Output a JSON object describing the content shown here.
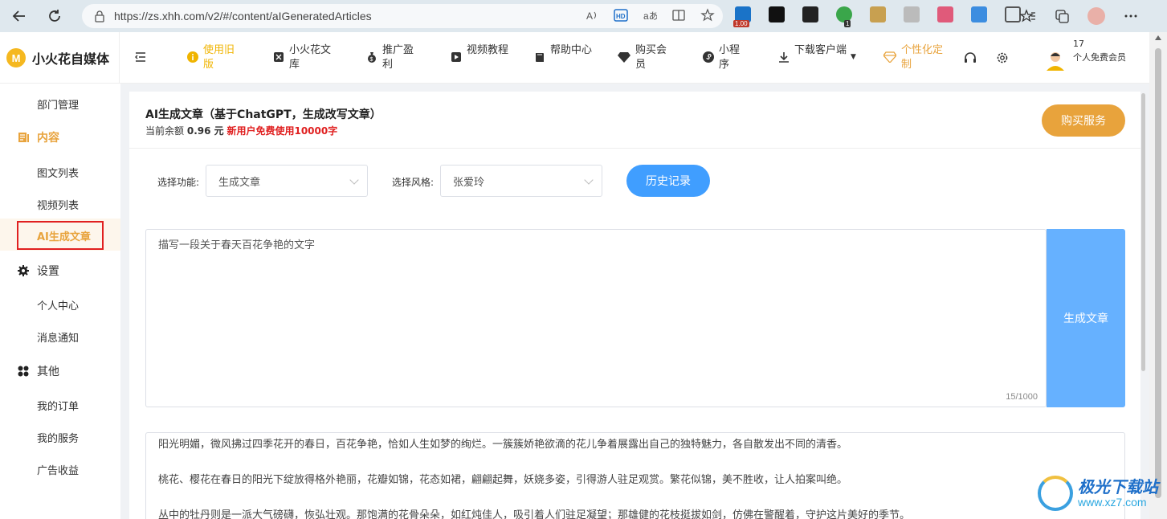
{
  "browser": {
    "url": "https://zs.xhh.com/v2/#/content/aIGeneratedArticles",
    "extension_badge": "1.00",
    "extension_count": "1"
  },
  "header": {
    "logo_text": "小火花自媒体",
    "logo_mark": "M",
    "nav": [
      {
        "label": "使用旧版",
        "icon": "info-icon"
      },
      {
        "label": "小火花文库",
        "icon": "library-icon"
      },
      {
        "label": "推广盈利",
        "icon": "money-bag-icon"
      },
      {
        "label": "视频教程",
        "icon": "video-icon"
      },
      {
        "label": "帮助中心",
        "icon": "book-icon"
      },
      {
        "label": "购买会员",
        "icon": "diamond-icon"
      },
      {
        "label": "小程序",
        "icon": "mini-program-icon"
      },
      {
        "label": "下载客户端",
        "icon": "download-icon"
      },
      {
        "label": "个性化定制",
        "icon": "gem-icon"
      }
    ],
    "user_id": "17",
    "user_level": "个人免费会员"
  },
  "sidebar": {
    "items": [
      {
        "label": "部门管理",
        "type": "sub"
      },
      {
        "label": "内容",
        "type": "group",
        "icon": "document-icon"
      },
      {
        "label": "图文列表",
        "type": "sub"
      },
      {
        "label": "视频列表",
        "type": "sub"
      },
      {
        "label": "AI生成文章",
        "type": "sub-active"
      },
      {
        "label": "设置",
        "type": "group",
        "icon": "gear-icon"
      },
      {
        "label": "个人中心",
        "type": "sub"
      },
      {
        "label": "消息通知",
        "type": "sub"
      },
      {
        "label": "其他",
        "type": "group",
        "icon": "grid-icon"
      },
      {
        "label": "我的订单",
        "type": "sub"
      },
      {
        "label": "我的服务",
        "type": "sub"
      },
      {
        "label": "广告收益",
        "type": "sub"
      }
    ]
  },
  "main": {
    "title": "AI生成文章（基于ChatGPT，生成改写文章）",
    "balance_prefix": "当前余额",
    "balance_value": "0.96 元",
    "promo": "新用户免费使用10000字",
    "buy_label": "购买服务",
    "function_label": "选择功能:",
    "function_value": "生成文章",
    "style_label": "选择风格:",
    "style_value": "张爱玲",
    "history_label": "历史记录",
    "prompt": "描写一段关于春天百花争艳的文字",
    "counter": "15/1000",
    "generate_label": "生成文章",
    "result": [
      "阳光明媚，微风拂过四季花开的春日，百花争艳，恰如人生如梦的绚烂。一簇簇娇艳欲滴的花儿争着展露出自己的独特魅力，各自散发出不同的清香。",
      "桃花、樱花在春日的阳光下绽放得格外艳丽，花瓣如锦，花态如裙，翩翩起舞，妖娆多姿，引得游人驻足观赏。繁花似锦，美不胜收，让人拍案叫绝。",
      "丛中的牡丹则是一派大气磅礴，恢弘壮观。那饱满的花骨朵朵，如红炖佳人，吸引着人们驻足凝望；那雄健的花枝挺拔如剑，仿佛在警醒着，守护这片美好的季节。"
    ]
  },
  "watermark": {
    "title": "极光下载站",
    "url": "www.xz7.com"
  },
  "colors": {
    "accent": "#e8a33c",
    "primary": "#409eff",
    "generate": "#66b1ff",
    "promo": "#e02020",
    "gold": "#f0b400"
  }
}
